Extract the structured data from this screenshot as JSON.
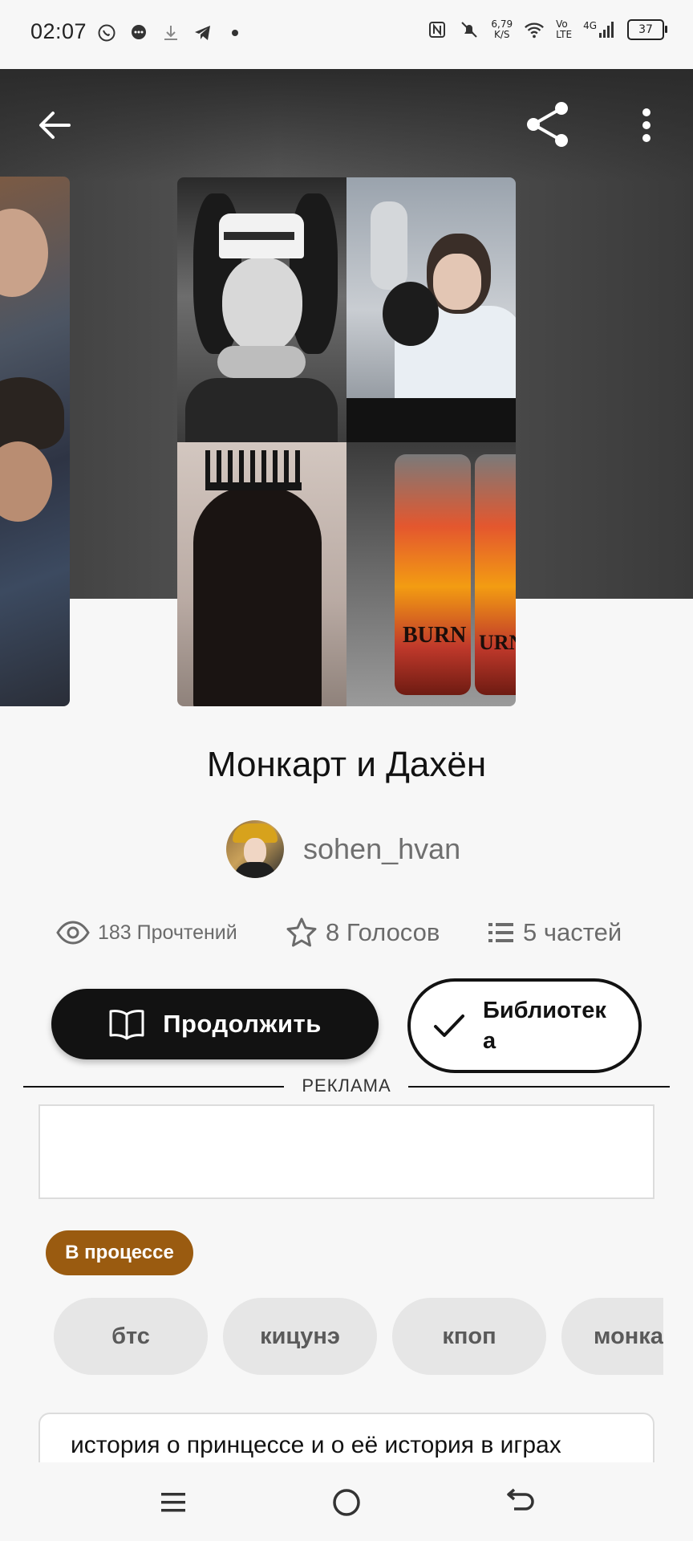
{
  "status_bar": {
    "time": "02:07",
    "speed_value": "6,79",
    "speed_unit": "K/S",
    "net_top": "Vo",
    "net_bottom": "LTE",
    "net_gen": "4G",
    "battery": "37"
  },
  "book": {
    "title": "Монкарт и Дахён",
    "author": "sohen_hvan",
    "cover_tiles": [
      "portrait-girl-cap",
      "girl-recording-studio",
      "crown-silhouette",
      "energy-drink-cans"
    ],
    "can_label": "BURN",
    "can_label_partial": "URN"
  },
  "stats": {
    "reads": "183 Прочтений",
    "votes": "8 Голосов",
    "parts": "5 частей"
  },
  "actions": {
    "continue_label": "Продолжить",
    "library_label": "Библиотека"
  },
  "ad": {
    "label": "РЕКЛАМА"
  },
  "status_tag": "В процессе",
  "tags": [
    "бтс",
    "кицунэ",
    "кпоп",
    "монка"
  ],
  "description": "история о принцессе и о её история в играх",
  "colors": {
    "primary": "#121212",
    "status_tag": "#9a5b10",
    "tag_bg": "#e6e6e6",
    "muted_text": "#6b6b6b"
  }
}
